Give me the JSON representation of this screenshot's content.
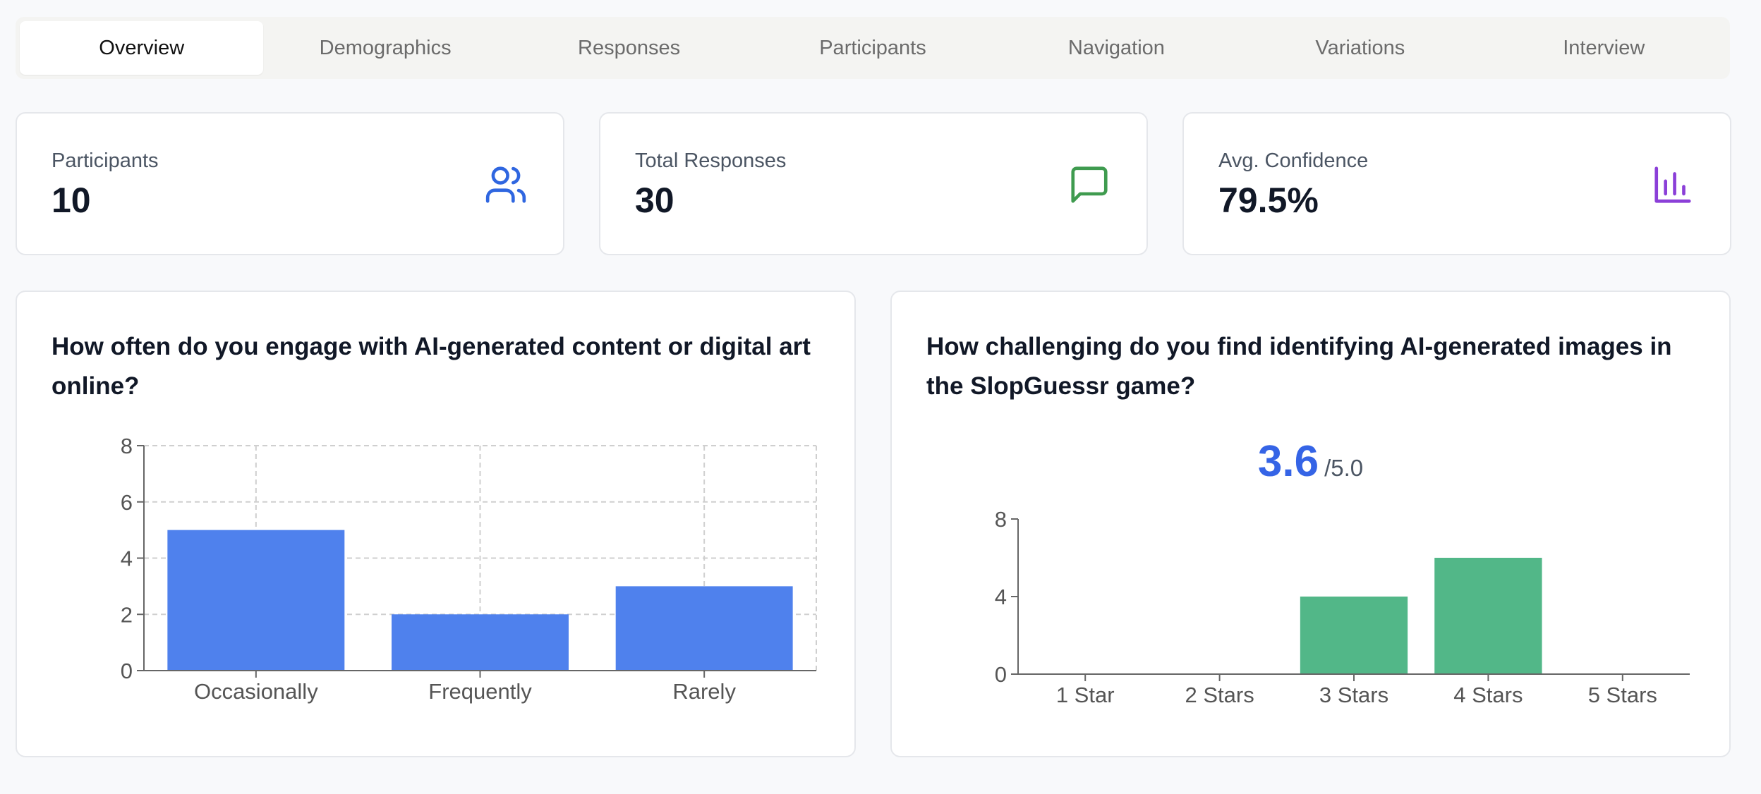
{
  "tabs": [
    {
      "label": "Overview",
      "active": true
    },
    {
      "label": "Demographics"
    },
    {
      "label": "Responses"
    },
    {
      "label": "Participants"
    },
    {
      "label": "Navigation"
    },
    {
      "label": "Variations"
    },
    {
      "label": "Interview"
    }
  ],
  "stats": [
    {
      "label": "Participants",
      "value": "10",
      "icon": "users-icon",
      "color": "#2f66e0"
    },
    {
      "label": "Total Responses",
      "value": "30",
      "icon": "message-square-icon",
      "color": "#3f9b4f"
    },
    {
      "label": "Avg. Confidence",
      "value": "79.5%",
      "icon": "bar-chart-icon",
      "color": "#8b3fd8"
    }
  ],
  "engagement": {
    "question": "How often do you engage with AI-generated content or digital art online?"
  },
  "challenge": {
    "question": "How challenging do you find identifying AI-generated images in the SlopGuessr game?",
    "rating": "3.6",
    "rating_max": "/5.0"
  },
  "chart_data": [
    {
      "type": "bar",
      "categories": [
        "Occasionally",
        "Frequently",
        "Rarely"
      ],
      "values": [
        5,
        2,
        3
      ],
      "ylim": [
        0,
        8
      ],
      "yticks": [
        "0",
        "2",
        "4",
        "6",
        "8"
      ],
      "grid": true,
      "color": "#4f81ed"
    },
    {
      "type": "bar",
      "categories": [
        "1 Star",
        "2 Stars",
        "3 Stars",
        "4 Stars",
        "5 Stars"
      ],
      "values": [
        0,
        0,
        4,
        6,
        0
      ],
      "ylim": [
        0,
        8
      ],
      "yticks": [
        "0",
        "4",
        "8"
      ],
      "grid": false,
      "color": "#52b788"
    }
  ]
}
